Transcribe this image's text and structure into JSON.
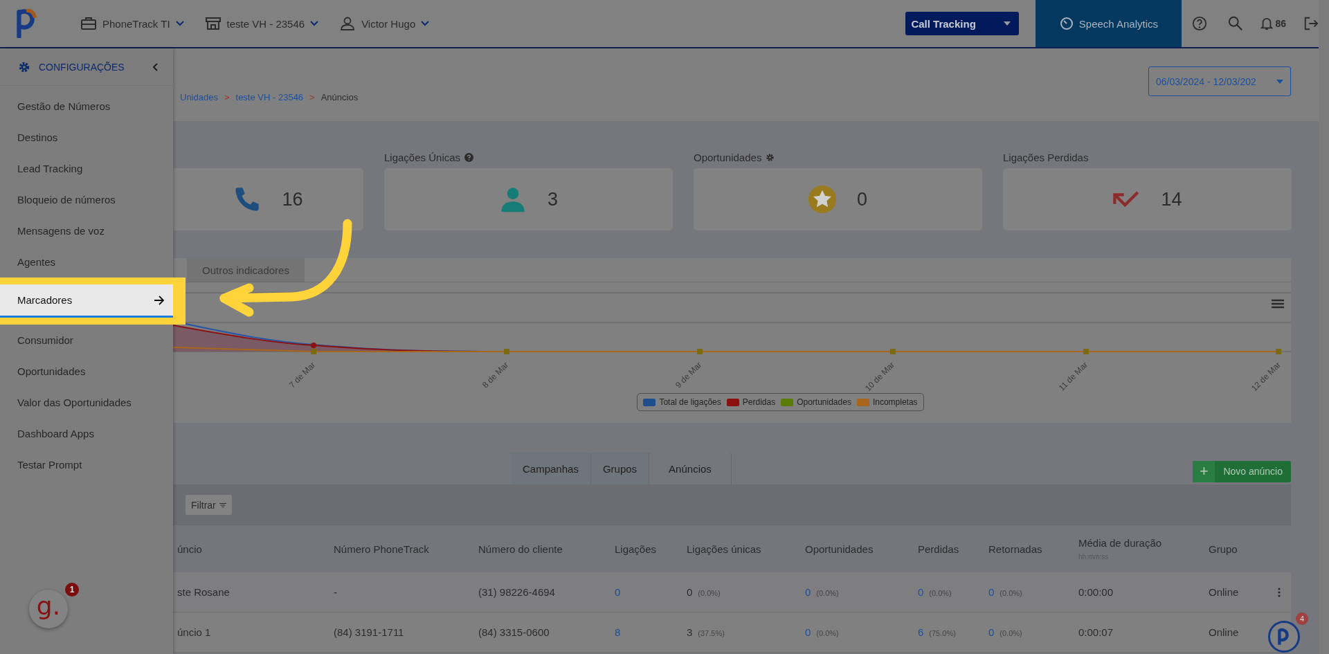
{
  "topbar": {
    "nav": [
      {
        "label": "PhoneTrack TI"
      },
      {
        "label": "teste VH - 23546"
      },
      {
        "label": "Victor Hugo"
      }
    ],
    "product_select": {
      "label": "Call Tracking"
    },
    "speech_button": {
      "label": "Speech Analytics"
    },
    "notifications": "86"
  },
  "sidebar": {
    "title": "CONFIGURAÇÕES",
    "items": [
      {
        "label": "Gestão de Números",
        "selected": false
      },
      {
        "label": "Destinos",
        "selected": false
      },
      {
        "label": "Lead Tracking",
        "selected": false
      },
      {
        "label": "Bloqueio de números",
        "selected": false
      },
      {
        "label": "Mensagens de voz",
        "selected": false
      },
      {
        "label": "Agentes",
        "selected": false
      },
      {
        "label": "Marcadores",
        "selected": true
      },
      {
        "label": "Consumidor",
        "selected": false
      },
      {
        "label": "Oportunidades",
        "selected": false
      },
      {
        "label": "Valor das Oportunidades",
        "selected": false
      },
      {
        "label": "Dashboard Apps",
        "selected": false
      },
      {
        "label": "Testar Prompt",
        "selected": false
      }
    ]
  },
  "breadcrumb": [
    "Unidades",
    "teste VH - 23546",
    "Anúncios"
  ],
  "breadcrumb_separator": ">",
  "date_range": "06/03/2024 - 12/03/202",
  "stats": [
    {
      "value": "16"
    },
    {
      "label": "Ligações Únicas",
      "value": "3"
    },
    {
      "label": "Oportunidades",
      "value": "0"
    },
    {
      "label": "Ligações Perdidas",
      "value": "14"
    }
  ],
  "chart": {
    "tab": "Outros indicadores",
    "x_labels": [
      "7 de Mar",
      "8 de Mar",
      "9 de Mar",
      "10 de Mar",
      "11 de Mar",
      "12 de Mar"
    ],
    "legend": [
      {
        "label": "Total de ligações",
        "color": "#1f4e8c"
      },
      {
        "label": "Perdidas",
        "color": "#8b1010"
      },
      {
        "label": "Oportunidades",
        "color": "#5a7d0a"
      },
      {
        "label": "Incompletas",
        "color": "#a8661c"
      }
    ]
  },
  "tabs": [
    {
      "label": "Campanhas",
      "selected": false
    },
    {
      "label": "Grupos",
      "selected": false
    },
    {
      "label": "Anúncios",
      "selected": true
    }
  ],
  "new_button": {
    "icon": "+",
    "label": "Novo anúncio"
  },
  "filter_button": "Filtrar",
  "table": {
    "columns": [
      {
        "label": "úncio"
      },
      {
        "label": "Número PhoneTrack"
      },
      {
        "label": "Número do cliente"
      },
      {
        "label": "Ligações"
      },
      {
        "label": "Ligações únicas"
      },
      {
        "label": "Oportunidades"
      },
      {
        "label": "Perdidas"
      },
      {
        "label": "Retornadas"
      },
      {
        "label": "Média de duração",
        "sub": "hh:mm:ss"
      },
      {
        "label": "Grupo"
      }
    ],
    "rows": [
      {
        "cells": [
          {
            "text": "ste Rosane",
            "link": false
          },
          {
            "text": "-",
            "link": false
          },
          {
            "text": "(31) 98226-4694",
            "link": false
          },
          {
            "text": "0",
            "link": true
          },
          {
            "text": "0",
            "pct": "(0.0%)",
            "link": false
          },
          {
            "text": "0",
            "pct": "(0.0%)",
            "link": true
          },
          {
            "text": "0",
            "pct": "(0.0%)",
            "link": true
          },
          {
            "text": "0",
            "pct": "(0.0%)",
            "link": true
          },
          {
            "text": "0:00:00",
            "link": false
          },
          {
            "text": "Online",
            "link": false
          }
        ]
      },
      {
        "cells": [
          {
            "text": "úncio 1",
            "link": false
          },
          {
            "text": "(84) 3191-1711",
            "link": false
          },
          {
            "text": "(84) 3315-0600",
            "link": false
          },
          {
            "text": "8",
            "link": true
          },
          {
            "text": "3",
            "pct": "(37.5%)",
            "link": false
          },
          {
            "text": "0",
            "pct": "(0.0%)",
            "link": true
          },
          {
            "text": "6",
            "pct": "(75.0%)",
            "link": true
          },
          {
            "text": "0",
            "pct": "(0.0%)",
            "link": true
          },
          {
            "text": "0:00:07",
            "link": false
          },
          {
            "text": "Online",
            "link": false
          }
        ]
      }
    ]
  },
  "chat_widget": {
    "logo": "g.",
    "badge": "1"
  },
  "help_widget": {
    "badge": "4"
  }
}
